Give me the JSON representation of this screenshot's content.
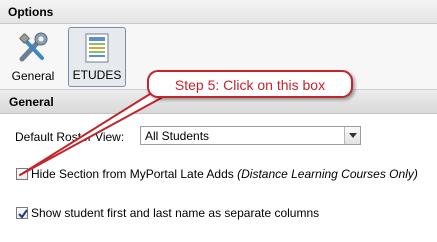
{
  "window": {
    "title": "Options"
  },
  "toolbar": {
    "buttons": [
      {
        "label": "General",
        "icon": "tools-icon"
      },
      {
        "label": "ETUDES",
        "icon": "document-icon",
        "selected": true
      }
    ]
  },
  "section": {
    "title": "General"
  },
  "roster": {
    "label": "Default Roster View:",
    "selected": "All Students"
  },
  "options": [
    {
      "label": "Hide Section from MyPortal Late Adds",
      "note": "(Distance Learning Courses Only)",
      "checked": false
    },
    {
      "label": "Show student first and last name as separate columns",
      "checked": true
    }
  ],
  "callout": {
    "text": "Step 5: Click on this box",
    "color": "#c0262c"
  }
}
